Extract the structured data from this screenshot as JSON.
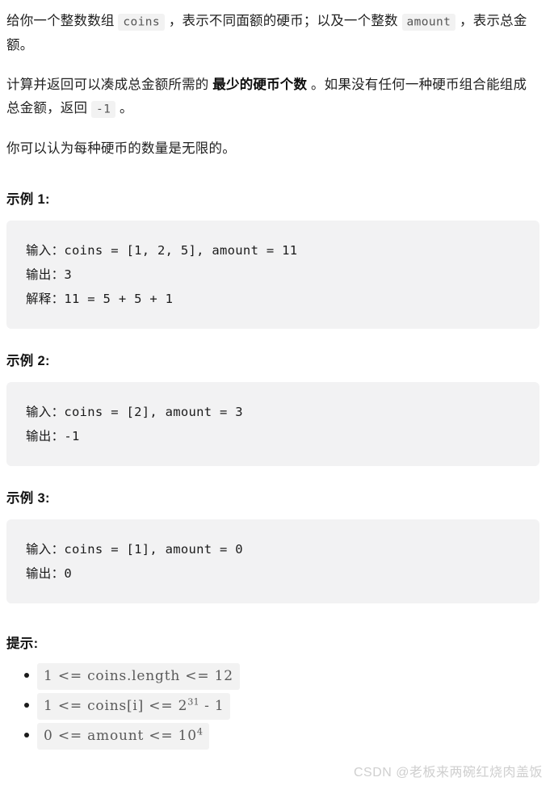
{
  "description": {
    "paragraphs": [
      {
        "id": "p1",
        "segments": [
          {
            "type": "text",
            "value": "给你一个整数数组 "
          },
          {
            "type": "code",
            "value": "coins"
          },
          {
            "type": "text",
            "value": " ，表示不同面额的硬币；以及一个整数 "
          },
          {
            "type": "code",
            "value": "amount"
          },
          {
            "type": "text",
            "value": " ，表示总金额。"
          }
        ]
      },
      {
        "id": "p2",
        "segments": [
          {
            "type": "text",
            "value": "计算并返回可以凑成总金额所需的 "
          },
          {
            "type": "bold",
            "value": "最少的硬币个数"
          },
          {
            "type": "text",
            "value": " 。如果没有任何一种硬币组合能组成总金额，返回 "
          },
          {
            "type": "code",
            "value": "-1"
          },
          {
            "type": "text",
            "value": " 。"
          }
        ]
      },
      {
        "id": "p3",
        "segments": [
          {
            "type": "text",
            "value": "你可以认为每种硬币的数量是无限的。"
          }
        ]
      }
    ],
    "p1_text_a": "给你一个整数数组 ",
    "p1_code_coins": "coins",
    "p1_text_b": " ，表示不同面额的硬币；以及一个整数 ",
    "p1_code_amount": "amount",
    "p1_text_c": " ，表示总金额。",
    "p2_text_a": "计算并返回可以凑成总金额所需的 ",
    "p2_bold": "最少的硬币个数",
    "p2_text_b": " 。如果没有任何一种硬币组合能组成总金额，返回 ",
    "p2_code_neg1": "-1",
    "p2_text_c": " 。",
    "p3_text": "你可以认为每种硬币的数量是无限的。"
  },
  "examples": [
    {
      "heading": "示例 1:",
      "code": "输入：coins = [1, 2, 5], amount = 11\n输出：3\n解释：11 = 5 + 5 + 1"
    },
    {
      "heading": "示例 2:",
      "code": "输入：coins = [2], amount = 3\n输出：-1"
    },
    {
      "heading": "示例 3:",
      "code": "输入：coins = [1], amount = 0\n输出：0"
    }
  ],
  "hints": {
    "heading": "提示:",
    "constraints": [
      {
        "id": "c1",
        "text": "1 <= coins.length <= 12",
        "lead": "1 <= coins.length <= 12",
        "sup": "",
        "tail": ""
      },
      {
        "id": "c2",
        "text": "1 <= coins[i] <= 2^31 - 1",
        "lead": "1 <= coins[i] <= 2",
        "sup": "31",
        "tail": " - 1"
      },
      {
        "id": "c3",
        "text": "0 <= amount <= 10^4",
        "lead": "0 <= amount <= 10",
        "sup": "4",
        "tail": ""
      }
    ]
  },
  "watermark": {
    "text": "CSDN @老板来两碗红烧肉盖饭"
  },
  "colors": {
    "page_background": "#ffffff",
    "body_text": "#1f1f1f",
    "code_chip_background": "#f2f2f2",
    "code_chip_text": "#555555",
    "code_block_background": "#f2f2f3",
    "code_block_text": "#1b1b1b",
    "math_text": "#5a5a5a",
    "watermark_text": "#cfcfcf"
  }
}
